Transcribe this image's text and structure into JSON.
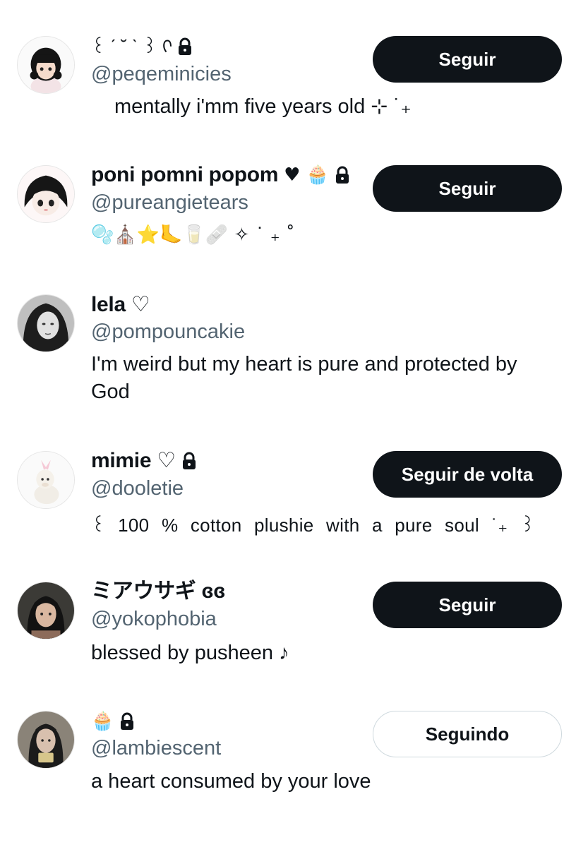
{
  "users": [
    {
      "name": "꒰ ˊ ˘ ˋ ꒱ ᢉ",
      "handle": "@peqeminicies",
      "bio": "mentally i'mm five years old ⊹ ˙₊",
      "button": "Seguir",
      "locked": true
    },
    {
      "name": "poni pomni popom",
      "name_emoji": "♥ 🧁",
      "handle": "@pureangietears",
      "bio": "🫧⛪⭐🦶🥛🩹 ✧ ˙ ₊ ˚",
      "button": "Seguir",
      "locked": true
    },
    {
      "name": "lela ♡",
      "handle": "@pompouncakie",
      "bio": "I'm weird but my heart is pure and protected by God",
      "button": "",
      "locked": false
    },
    {
      "name": "mimie ♡",
      "handle": "@dooletie",
      "bio": "꒰ 100 % cotton plushie with a pure soul ˙₊ ꒱",
      "button": "Seguir de volta",
      "locked": true
    },
    {
      "name": "ミアウサギ ɞɞ",
      "handle": "@yokophobia",
      "bio": "blessed by pusheen ♪",
      "button": "Seguir",
      "locked": false
    },
    {
      "name": "🧁",
      "handle": "@lambiescent",
      "bio": "a heart consumed by your love",
      "button": "Seguindo",
      "locked": true
    }
  ],
  "colors": {
    "text": "#0f1419",
    "muted": "#536471",
    "button_bg": "#0f1419",
    "button_text": "#ffffff",
    "outline_border": "#cfd9de"
  }
}
